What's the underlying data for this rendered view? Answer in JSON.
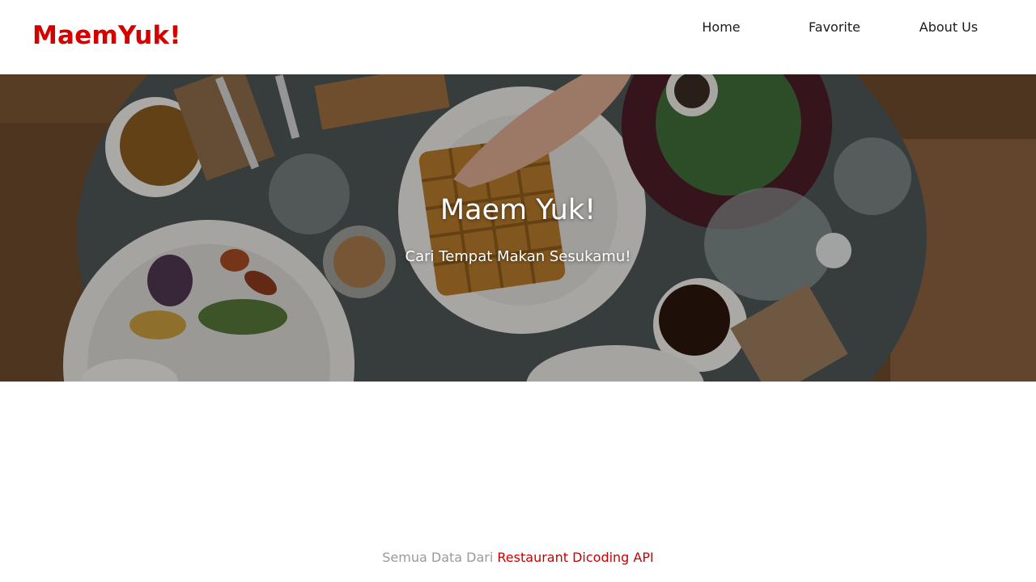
{
  "app_bar": {
    "brand": "MaemYuk!",
    "nav": [
      "Home",
      "Favorite",
      "About Us"
    ]
  },
  "hero": {
    "title": "Maem Yuk!",
    "tagline": "Cari Tempat Makan Sesukamu!"
  },
  "footer": {
    "prefix": "Semua Data Dari",
    "link": "Restaurant Dicoding API"
  },
  "colors": {
    "brand": "#d40000",
    "link": "#c80000",
    "muted": "#9a9a9a"
  }
}
